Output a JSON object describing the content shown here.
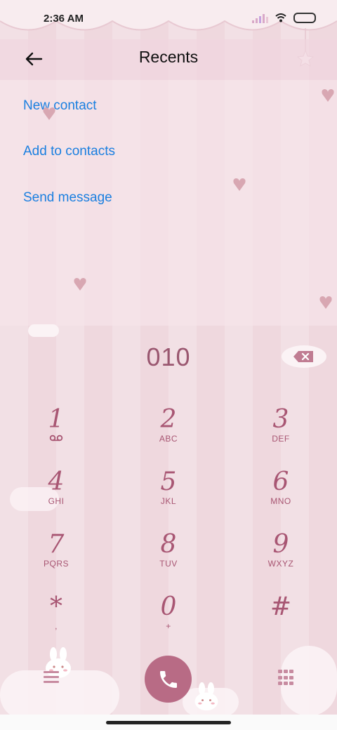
{
  "status": {
    "time": "2:36 AM"
  },
  "header": {
    "title": "Recents",
    "back_icon": "arrow-left-icon"
  },
  "menu": {
    "items": [
      {
        "label": "New contact"
      },
      {
        "label": "Add to contacts"
      },
      {
        "label": "Send message"
      }
    ]
  },
  "dialer": {
    "number": "010",
    "keys": [
      {
        "digit": "1",
        "letters": ""
      },
      {
        "digit": "2",
        "letters": "ABC"
      },
      {
        "digit": "3",
        "letters": "DEF"
      },
      {
        "digit": "4",
        "letters": "GHI"
      },
      {
        "digit": "5",
        "letters": "JKL"
      },
      {
        "digit": "6",
        "letters": "MNO"
      },
      {
        "digit": "7",
        "letters": "PQRS"
      },
      {
        "digit": "8",
        "letters": "TUV"
      },
      {
        "digit": "9",
        "letters": "WXYZ"
      },
      {
        "digit": "*",
        "letters": ","
      },
      {
        "digit": "0",
        "letters": "+"
      },
      {
        "digit": "#",
        "letters": ""
      }
    ]
  },
  "colors": {
    "accent_link": "#1a7fe0",
    "dial_text": "#a85673",
    "call_button": "#b86b85"
  }
}
